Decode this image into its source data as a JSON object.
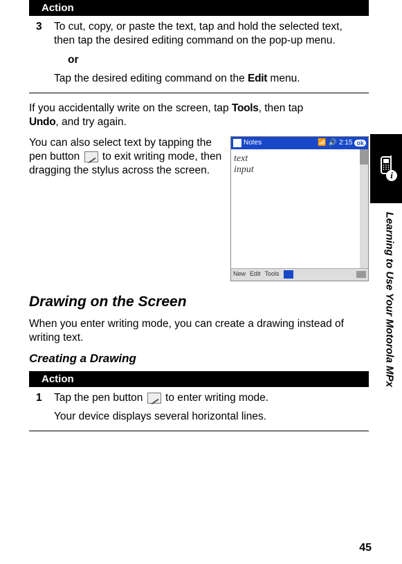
{
  "action_header": "Action",
  "step3": {
    "num": "3",
    "text_a": "To cut, copy, or paste the text, tap and hold the selected text, then tap the desired editing command on the pop-up menu.",
    "or": "or",
    "text_b_pre": "Tap the desired editing command on the ",
    "text_b_bold": "Edit",
    "text_b_post": " menu."
  },
  "undo_para_pre": "If you accidentally write on the screen, tap ",
  "undo_bold1": "Tools",
  "undo_mid": ", then tap ",
  "undo_bold2": "Undo",
  "undo_post": ", and try again.",
  "select_para_a": "You can also select text by tapping the pen button ",
  "select_para_b": " to exit writing mode, then dragging the stylus across the screen.",
  "screenshot": {
    "title": "Notes",
    "time": "2:15",
    "ok": "ok",
    "hw1": "text",
    "hw2": "input",
    "menu_new": "New",
    "menu_edit": "Edit",
    "menu_tools": "Tools"
  },
  "section_heading": "Drawing on the Screen",
  "drawing_para": "When you enter writing mode, you can create a drawing instead of writing text.",
  "sub_heading": "Creating a Drawing",
  "action_header2": "Action",
  "step1": {
    "num": "1",
    "text_a": "Tap the pen button ",
    "text_b": " to enter writing mode.",
    "text_c": "Your device displays several horizontal lines."
  },
  "side_text": "Learning to Use Your Motorola MPx",
  "page_number": "45"
}
